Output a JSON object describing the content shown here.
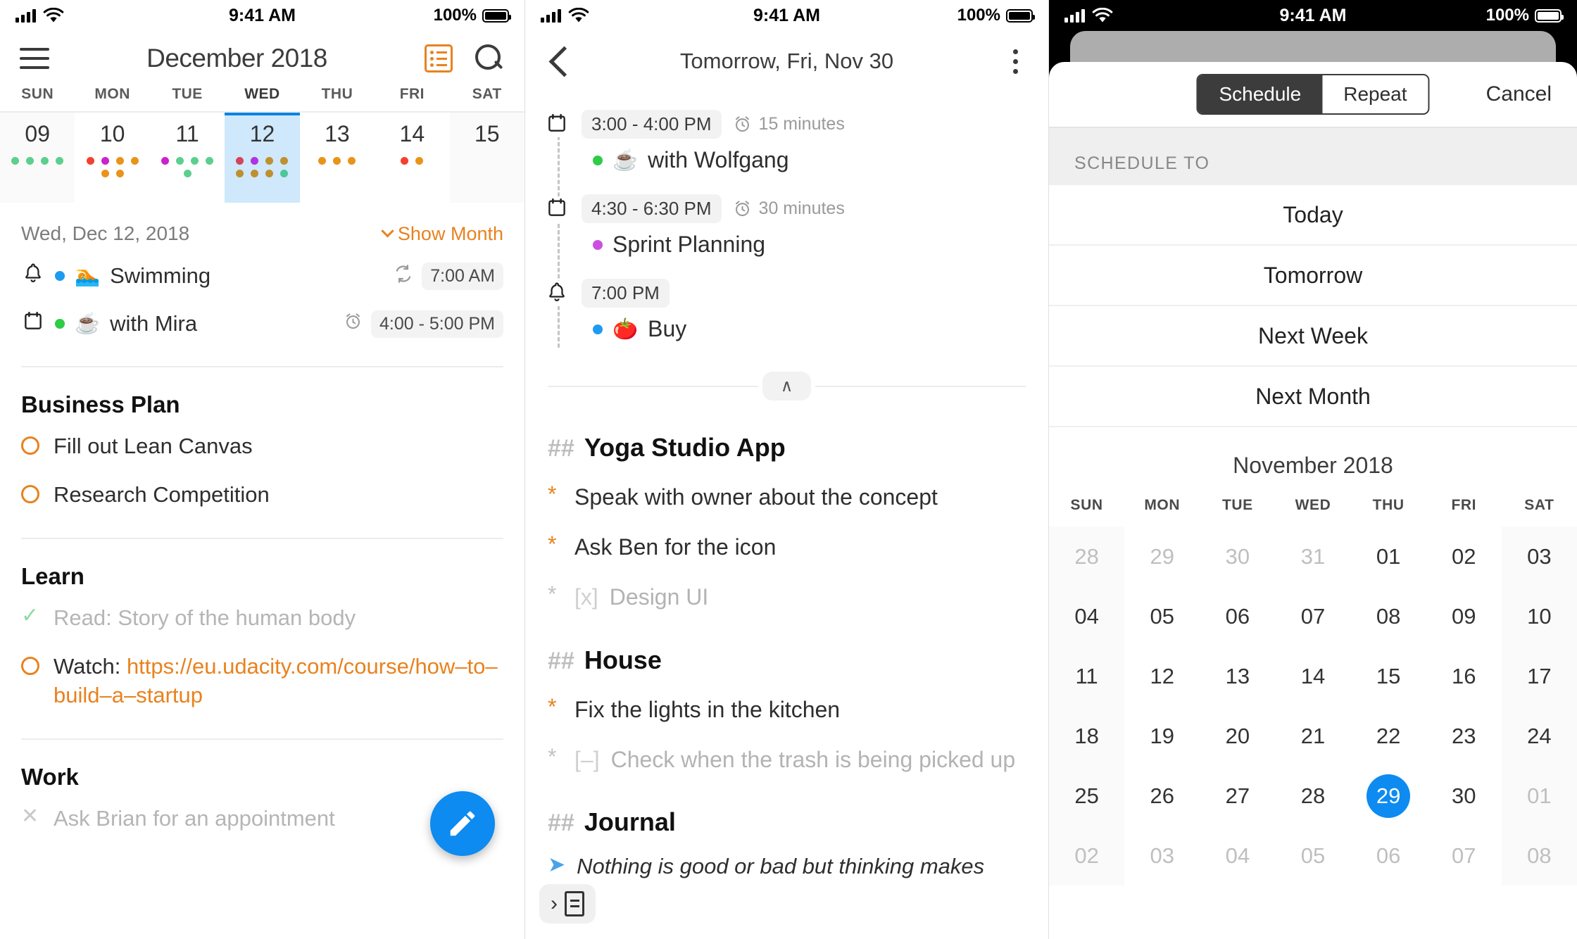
{
  "status_bar": {
    "time": "9:41 AM",
    "battery": "100%",
    "signal_icon": "cellular-signal-icon",
    "wifi_icon": "wifi-icon"
  },
  "screen1": {
    "menu_icon": "hamburger-menu-icon",
    "title": "December 2018",
    "list_icon": "agenda-list-icon",
    "search_icon": "search-icon",
    "weekdays": [
      "SUN",
      "MON",
      "TUE",
      "WED",
      "THU",
      "FRI",
      "SAT"
    ],
    "days": [
      {
        "num": "09",
        "weekend": true,
        "today": false,
        "dots": [
          "#5ccf8f",
          "#5ccf8f",
          "#5ccf8f",
          "#5ccf8f"
        ]
      },
      {
        "num": "10",
        "weekend": false,
        "today": false,
        "dots": [
          "#f53f2e",
          "#cc22cc",
          "#e8941a",
          "#e8941a",
          "#e8941a",
          "#e8941a"
        ]
      },
      {
        "num": "11",
        "weekend": false,
        "today": false,
        "dots": [
          "#cc22cc",
          "#5ccf8f",
          "#5ccf8f",
          "#5ccf8f",
          "#5ccf8f"
        ]
      },
      {
        "num": "12",
        "weekend": false,
        "today": true,
        "dots": [
          "#d4445c",
          "#b032e0",
          "#bf9030",
          "#bf9030",
          "#bf9030",
          "#bf9030",
          "#bf9030",
          "#4cc69a"
        ]
      },
      {
        "num": "13",
        "weekend": false,
        "today": false,
        "dots": [
          "#e8941a",
          "#e8941a",
          "#e8941a"
        ]
      },
      {
        "num": "14",
        "weekend": false,
        "today": false,
        "dots": [
          "#f53f2e",
          "#e8941a"
        ]
      },
      {
        "num": "15",
        "weekend": true,
        "today": false,
        "dots": []
      }
    ],
    "selected_date_label": "Wed, Dec 12, 2018",
    "show_month_label": "Show Month",
    "events": [
      {
        "glyph": "bell-icon",
        "dot_color": "#1e9bf0",
        "emoji": "🏊",
        "title": "Swimming",
        "aux_icon": "repeat-icon",
        "time": "7:00 AM"
      },
      {
        "glyph": "calendar-icon",
        "dot_color": "#2ecc47",
        "emoji": "☕",
        "title": "with Mira",
        "aux_icon": "alarm-icon",
        "time": "4:00 - 5:00 PM"
      }
    ],
    "sections": [
      {
        "title": "Business Plan",
        "tasks": [
          {
            "state": "open",
            "text": "Fill out Lean Canvas"
          },
          {
            "state": "open",
            "text": "Research Competition"
          }
        ]
      },
      {
        "title": "Learn",
        "tasks": [
          {
            "state": "done",
            "text": "Read: Story of the human body"
          },
          {
            "state": "open",
            "text": "Watch: ",
            "link": "https://eu.udacity.com/course/how–to–build–a–startup"
          }
        ]
      },
      {
        "title": "Work",
        "tasks": [
          {
            "state": "cancelled",
            "text": "Ask Brian for an appointment"
          }
        ]
      }
    ],
    "fab_icon": "edit-pencil-icon"
  },
  "screen2": {
    "back_icon": "back-chevron-icon",
    "title": "Tomorrow, Fri, Nov 30",
    "more_icon": "kebab-menu-icon",
    "timeline": [
      {
        "glyph": "calendar-icon",
        "time": "3:00 - 4:00 PM",
        "alarm_icon": "alarm-icon",
        "alarm": "15 minutes",
        "dot_color": "#2ecc47",
        "emoji": "☕",
        "title": "with Wolfgang"
      },
      {
        "glyph": "calendar-icon",
        "time": "4:30 - 6:30 PM",
        "alarm_icon": "alarm-icon",
        "alarm": "30 minutes",
        "dot_color": "#cc4fe0",
        "emoji": "",
        "title": "Sprint Planning"
      },
      {
        "glyph": "bell-icon",
        "time": "7:00 PM",
        "alarm_icon": "",
        "alarm": "",
        "dot_color": "#1e9bf0",
        "emoji": "🍅",
        "title": "Buy "
      }
    ],
    "collapse_caret": "∧",
    "notes": [
      {
        "hash": "##",
        "heading": "Yoga Studio App",
        "items": [
          {
            "marker": "*",
            "dim": false,
            "bracket": "",
            "text": "Speak with owner about the concept"
          },
          {
            "marker": "*",
            "dim": false,
            "bracket": "",
            "text": "Ask Ben for the icon"
          },
          {
            "marker": "*",
            "dim": true,
            "bracket": "[x]",
            "text": "Design UI"
          }
        ]
      },
      {
        "hash": "##",
        "heading": "House",
        "items": [
          {
            "marker": "*",
            "dim": false,
            "bracket": "",
            "text": "Fix the lights in the kitchen"
          },
          {
            "marker": "*",
            "dim": true,
            "bracket": "[–]",
            "text": "Check when the trash is being picked up"
          }
        ]
      },
      {
        "hash": "##",
        "heading": "Journal",
        "items": []
      }
    ],
    "journal_quote": "Nothing is good or bad but thinking makes",
    "doc_button_icon": "document-page-icon",
    "doc_button_arrow": "›"
  },
  "screen3": {
    "segment": {
      "options": [
        "Schedule",
        "Repeat"
      ],
      "active": "Schedule"
    },
    "cancel_label": "Cancel",
    "section_header": "SCHEDULE TO",
    "options": [
      "Today",
      "Tomorrow",
      "Next Week",
      "Next Month"
    ],
    "calendar": {
      "title": "November 2018",
      "weekdays": [
        "SUN",
        "MON",
        "TUE",
        "WED",
        "THU",
        "FRI",
        "SAT"
      ],
      "weeks": [
        [
          {
            "d": "28",
            "m": true
          },
          {
            "d": "29",
            "m": true
          },
          {
            "d": "30",
            "m": true
          },
          {
            "d": "31",
            "m": true
          },
          {
            "d": "01",
            "m": false
          },
          {
            "d": "02",
            "m": false
          },
          {
            "d": "03",
            "m": false
          }
        ],
        [
          {
            "d": "04",
            "m": false
          },
          {
            "d": "05",
            "m": false
          },
          {
            "d": "06",
            "m": false
          },
          {
            "d": "07",
            "m": false
          },
          {
            "d": "08",
            "m": false
          },
          {
            "d": "09",
            "m": false
          },
          {
            "d": "10",
            "m": false
          }
        ],
        [
          {
            "d": "11",
            "m": false
          },
          {
            "d": "12",
            "m": false
          },
          {
            "d": "13",
            "m": false
          },
          {
            "d": "14",
            "m": false
          },
          {
            "d": "15",
            "m": false
          },
          {
            "d": "16",
            "m": false
          },
          {
            "d": "17",
            "m": false
          }
        ],
        [
          {
            "d": "18",
            "m": false
          },
          {
            "d": "19",
            "m": false
          },
          {
            "d": "20",
            "m": false
          },
          {
            "d": "21",
            "m": false
          },
          {
            "d": "22",
            "m": false
          },
          {
            "d": "23",
            "m": false
          },
          {
            "d": "24",
            "m": false
          }
        ],
        [
          {
            "d": "25",
            "m": false
          },
          {
            "d": "26",
            "m": false
          },
          {
            "d": "27",
            "m": false
          },
          {
            "d": "28",
            "m": false
          },
          {
            "d": "29",
            "m": false,
            "sel": true
          },
          {
            "d": "30",
            "m": false
          },
          {
            "d": "01",
            "m": true
          }
        ],
        [
          {
            "d": "02",
            "m": true
          },
          {
            "d": "03",
            "m": true
          },
          {
            "d": "04",
            "m": true
          },
          {
            "d": "05",
            "m": true
          },
          {
            "d": "06",
            "m": true
          },
          {
            "d": "07",
            "m": true
          },
          {
            "d": "08",
            "m": true
          }
        ]
      ],
      "selected_day": "29",
      "accent": "#0d8bf0"
    }
  },
  "colors": {
    "accent_orange": "#e8821e",
    "accent_blue": "#0d8bf0",
    "today_bg": "#cfe8fb"
  }
}
